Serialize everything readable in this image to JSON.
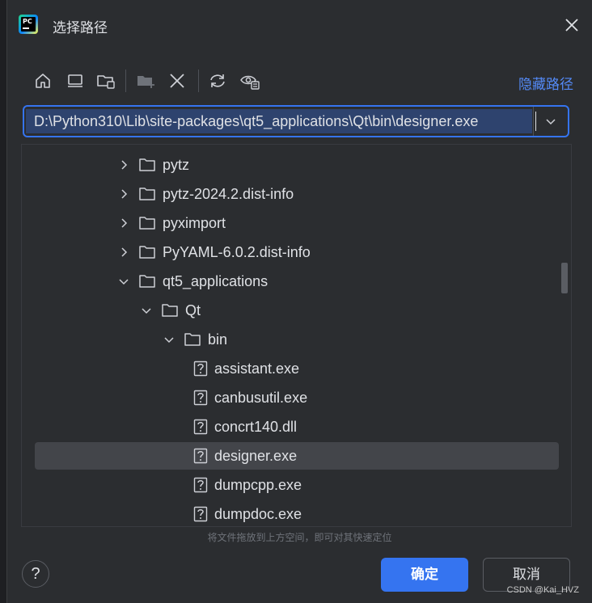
{
  "window": {
    "title": "选择路径",
    "app_logo_text": "PC"
  },
  "toolbar": {
    "buttons": [
      {
        "icon": "home-icon"
      },
      {
        "icon": "desktop-icon"
      },
      {
        "icon": "project-folder-icon"
      },
      {
        "icon": "new-folder-icon"
      },
      {
        "icon": "delete-icon"
      },
      {
        "icon": "refresh-icon"
      },
      {
        "icon": "show-hidden-icon"
      }
    ],
    "hide_path_label": "隐藏路径"
  },
  "path_field": {
    "value": "D:\\Python310\\Lib\\site-packages\\qt5_applications\\Qt\\bin\\designer.exe"
  },
  "tree": {
    "rows": [
      {
        "label": "pytz",
        "type": "folder",
        "expanded": false
      },
      {
        "label": "pytz-2024.2.dist-info",
        "type": "folder",
        "expanded": false
      },
      {
        "label": "pyximport",
        "type": "folder",
        "expanded": false
      },
      {
        "label": "PyYAML-6.0.2.dist-info",
        "type": "folder",
        "expanded": false
      },
      {
        "label": "qt5_applications",
        "type": "folder",
        "expanded": true
      },
      {
        "label": "Qt",
        "type": "folder",
        "expanded": true
      },
      {
        "label": "bin",
        "type": "folder",
        "expanded": true
      },
      {
        "label": "assistant.exe",
        "type": "file"
      },
      {
        "label": "canbusutil.exe",
        "type": "file"
      },
      {
        "label": "concrt140.dll",
        "type": "file"
      },
      {
        "label": "designer.exe",
        "type": "file",
        "selected": true
      },
      {
        "label": "dumpcpp.exe",
        "type": "file"
      },
      {
        "label": "dumpdoc.exe",
        "type": "file"
      }
    ],
    "hint": "将文件拖放到上方空间，即可对其快速定位"
  },
  "footer": {
    "help_label": "?",
    "ok_label": "确定",
    "cancel_label": "取消"
  },
  "watermark": "CSDN @Kai_HVZ",
  "colors": {
    "accent": "#3574f0",
    "link": "#548af7",
    "background": "#2b2d30",
    "selection": "#43454a"
  }
}
